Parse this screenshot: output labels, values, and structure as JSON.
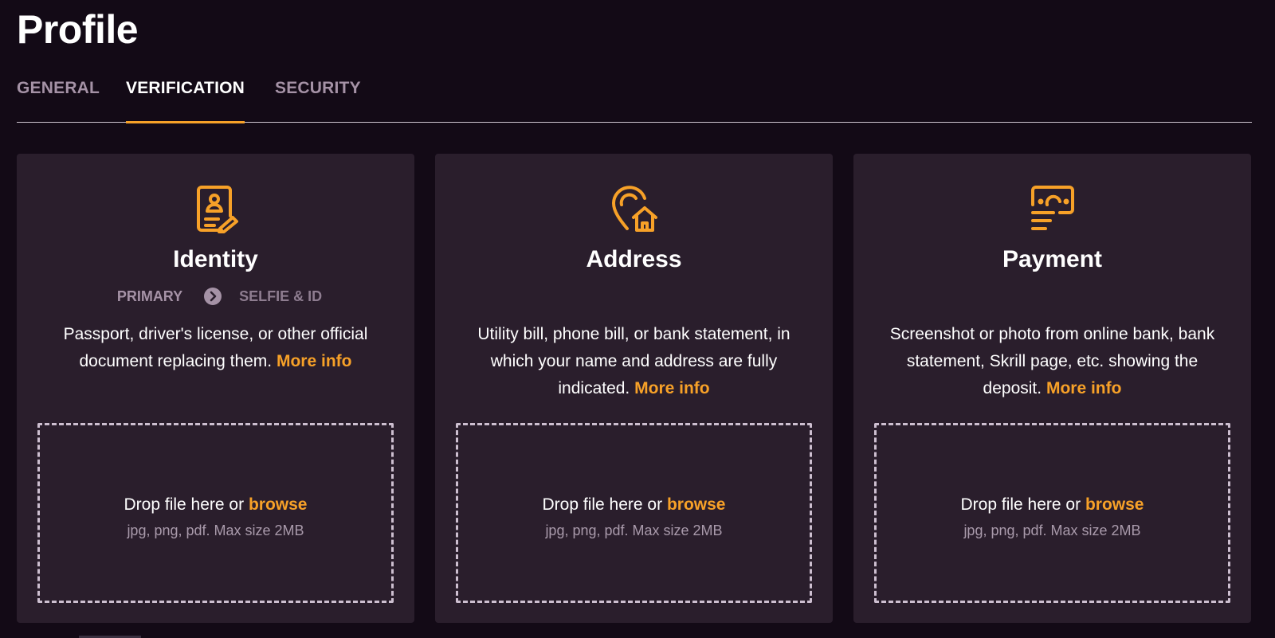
{
  "header": {
    "title": "Profile"
  },
  "tabs": [
    {
      "label": "GENERAL"
    },
    {
      "label": "VERIFICATION"
    },
    {
      "label": "SECURITY"
    }
  ],
  "active_tab": "VERIFICATION",
  "accent_color": "#f7a128",
  "cards": [
    {
      "icon": "id-document-icon",
      "title": "Identity",
      "steps": [
        "PRIMARY",
        "SELFIE & ID"
      ],
      "description": "Passport, driver's license, or other official document replacing them.",
      "more_info": "More info",
      "drop_text": "Drop file here or",
      "browse": "browse",
      "hint": "jpg, png, pdf. Max size 2MB"
    },
    {
      "icon": "location-home-icon",
      "title": "Address",
      "description": "Utility bill, phone bill, or bank statement, in which your name and address are fully indicated.",
      "more_info": "More info",
      "drop_text": "Drop file here or",
      "browse": "browse",
      "hint": "jpg, png, pdf. Max size 2MB"
    },
    {
      "icon": "payment-cash-icon",
      "title": "Payment",
      "description": "Screenshot or photo from online bank, bank statement, Skrill page, etc. showing the deposit.",
      "more_info": "More info",
      "drop_text": "Drop file here or",
      "browse": "browse",
      "hint": "jpg, png, pdf. Max size 2MB"
    }
  ]
}
